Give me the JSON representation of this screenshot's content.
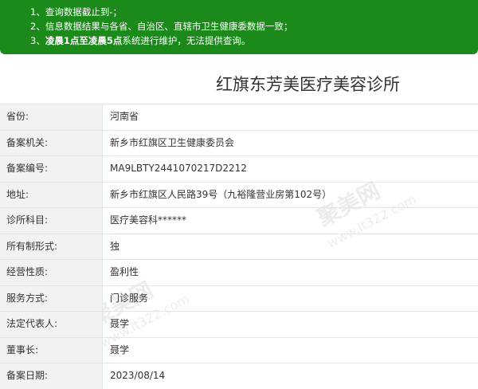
{
  "notice": {
    "line1": "1、查询数据截止到-；",
    "line2": "2、信息数据结果与各省、自治区、直辖市卫生健康委数据一致；",
    "line3_prefix": "3、",
    "line3_bold": "凌晨1点至凌晨5点",
    "line3_suffix": "系统进行维护，无法提供查询。"
  },
  "title": "红旗东芳美医疗美容诊所",
  "watermark": {
    "brand": "聚美网",
    "url": "www.it322.com"
  },
  "records": [
    {
      "label": "省份:",
      "value": "河南省"
    },
    {
      "label": "备案机关:",
      "value": "新乡市红旗区卫生健康委员会"
    },
    {
      "label": "备案编号:",
      "value": "MA9LBTY2441070217D2212"
    },
    {
      "label": "地址:",
      "value": "新乡市红旗区人民路39号（九裕隆营业房第102号）"
    },
    {
      "label": "诊所科目:",
      "value": "医疗美容科******"
    },
    {
      "label": "所有制形式:",
      "value": "独"
    },
    {
      "label": "经营性质:",
      "value": "盈利性"
    },
    {
      "label": "服务方式:",
      "value": "门诊服务"
    },
    {
      "label": "法定代表人:",
      "value": "聂学"
    },
    {
      "label": "董事长:",
      "value": "聂学"
    },
    {
      "label": "备案日期:",
      "value": "2023/08/14"
    }
  ]
}
